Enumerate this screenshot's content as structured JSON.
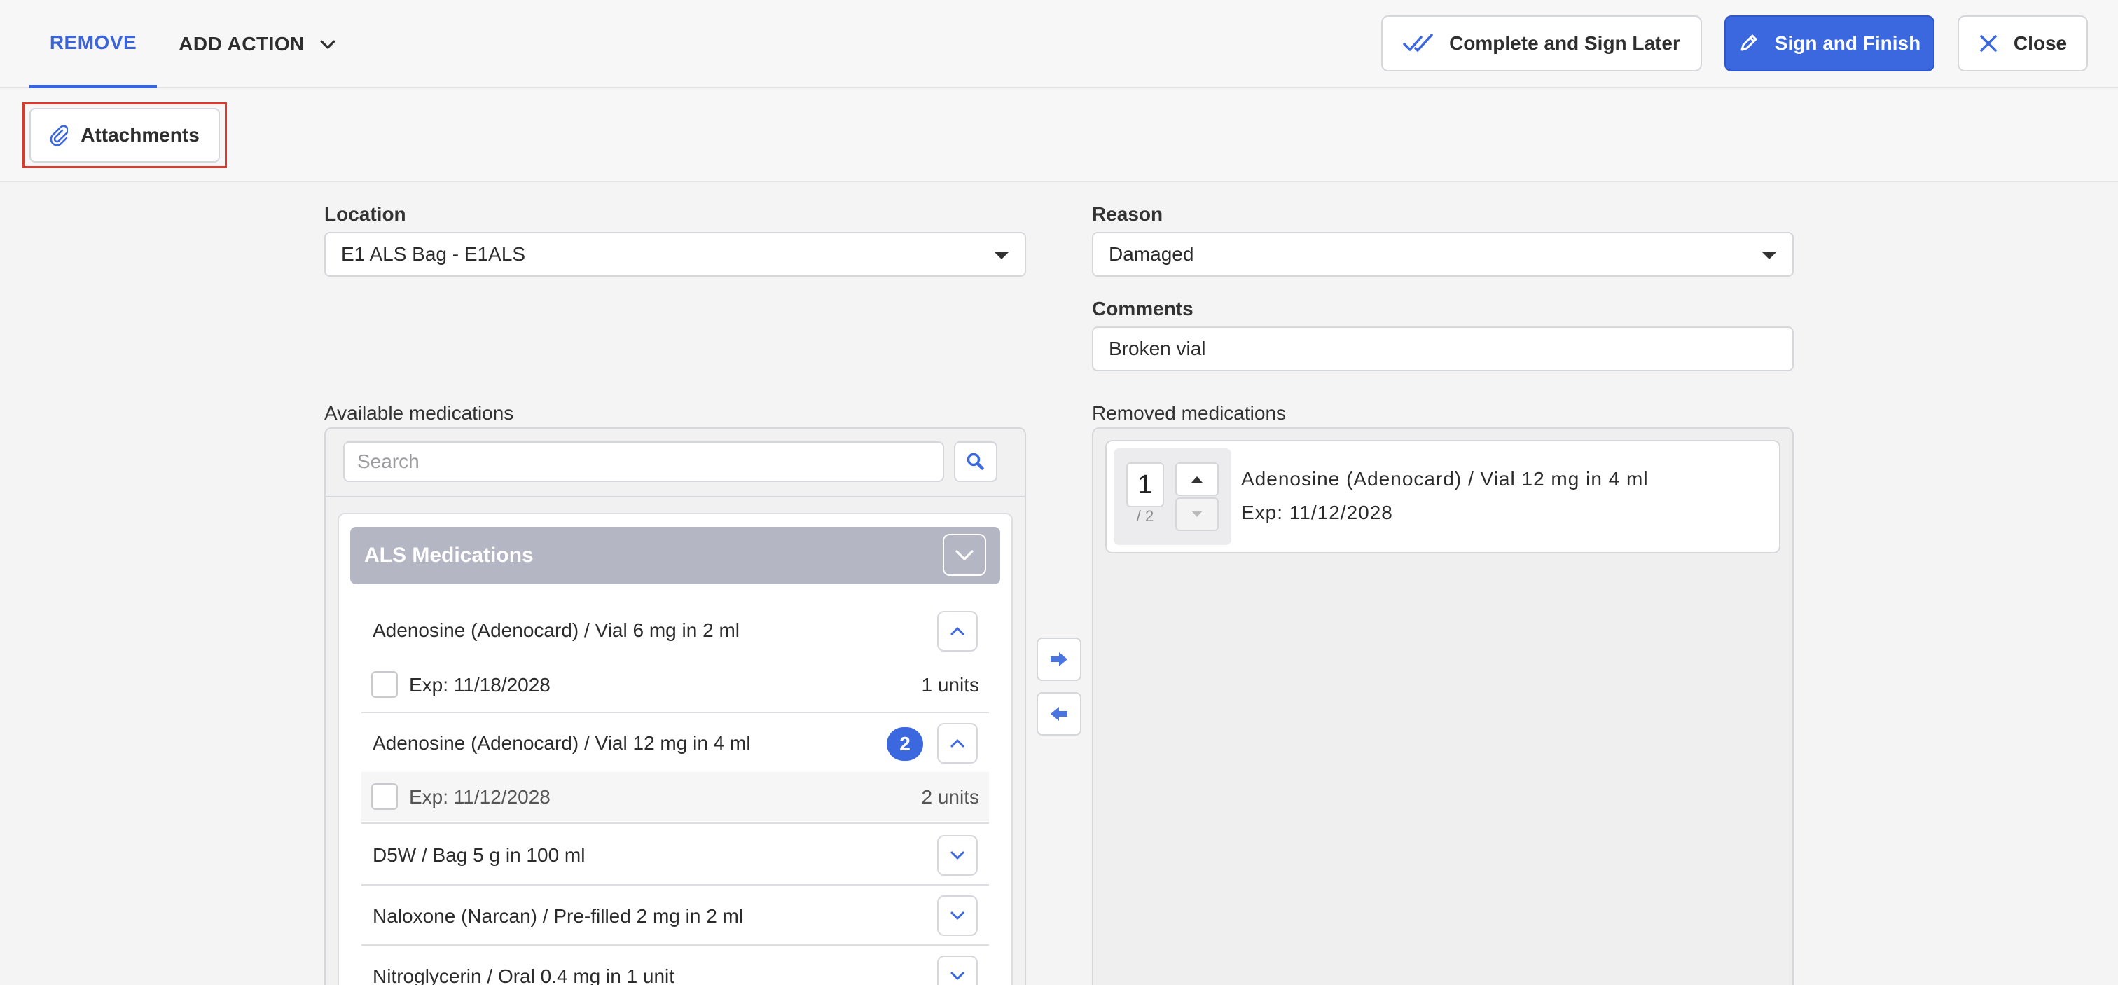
{
  "header": {
    "tab_remove": "REMOVE",
    "tab_add_action": "ADD ACTION",
    "complete_later_label": "Complete and Sign Later",
    "sign_finish_label": "Sign and Finish",
    "close_label": "Close"
  },
  "toolbar": {
    "attachments_label": "Attachments"
  },
  "form": {
    "location_label": "Location",
    "location_value": "E1 ALS Bag - E1ALS",
    "reason_label": "Reason",
    "reason_value": "Damaged",
    "comments_label": "Comments",
    "comments_value": "Broken vial"
  },
  "available": {
    "title": "Available medications",
    "search_placeholder": "Search",
    "group_name": "ALS Medications",
    "meds": [
      {
        "name": "Adenosine (Adenocard) / Vial 6 mg in 2 ml",
        "exp": "Exp: 11/18/2028",
        "units": "1 units"
      },
      {
        "name": "Adenosine (Adenocard) / Vial 12 mg in 4 ml",
        "badge": "2",
        "exp": "Exp: 11/12/2028",
        "units": "2 units"
      },
      {
        "name": "D5W / Bag 5 g in 100 ml"
      },
      {
        "name": "Naloxone (Narcan) / Pre-filled 2 mg in 2 ml"
      },
      {
        "name": "Nitroglycerin / Oral 0.4 mg in 1 unit"
      }
    ]
  },
  "removed": {
    "title": "Removed medications",
    "items": [
      {
        "qty": "1",
        "max": "/ 2",
        "name": "Adenosine (Adenocard) / Vial 12 mg in 4 ml",
        "exp": "Exp: 11/12/2028"
      }
    ]
  },
  "colors": {
    "accent": "#3b67df",
    "highlight": "#d93a2b",
    "group_header": "#b4b7c3"
  }
}
